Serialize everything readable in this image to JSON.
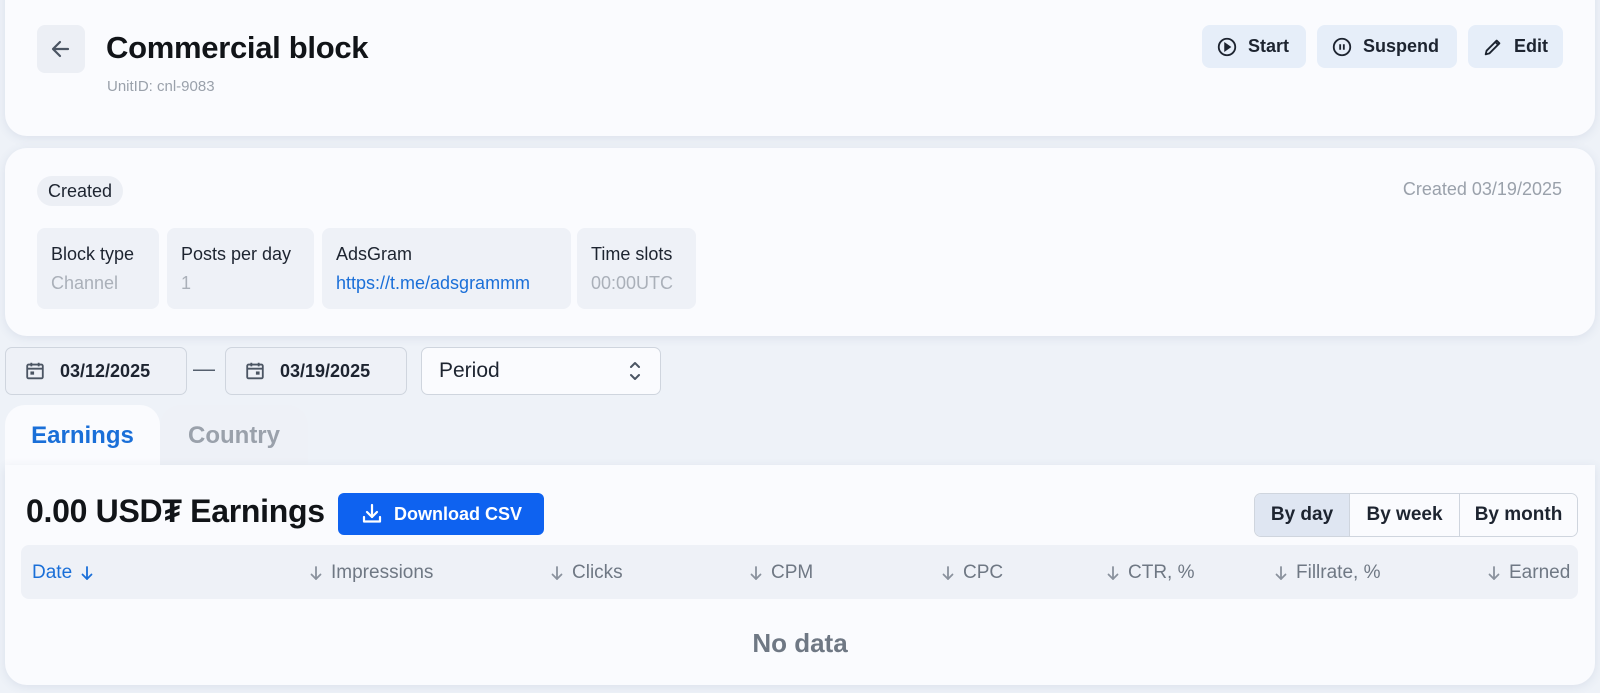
{
  "header": {
    "title": "Commercial block",
    "unit_id": "UnitID: cnl-9083",
    "actions": {
      "start": "Start",
      "suspend": "Suspend",
      "edit": "Edit"
    },
    "icons": [
      "arrow-left-icon",
      "play-circle-icon",
      "pause-circle-icon",
      "pencil-icon"
    ]
  },
  "info": {
    "status": "Created",
    "created": "Created 03/19/2025",
    "properties": [
      {
        "label": "Block type",
        "value": "Channel"
      },
      {
        "label": "Posts per day",
        "value": "1"
      },
      {
        "label": "AdsGram",
        "value": "https://t.me/adsgrammm"
      },
      {
        "label": "Time slots",
        "value": "00:00UTC"
      }
    ]
  },
  "filters": {
    "date_from": "03/12/2025",
    "separator": "—",
    "date_to": "03/19/2025",
    "period": "Period"
  },
  "tabs": [
    {
      "label": "Earnings",
      "active": true
    },
    {
      "label": "Country",
      "active": false
    }
  ],
  "earnings": {
    "title": "0.00 USD₮ Earnings",
    "download_label": "Download CSV",
    "granularity": [
      {
        "label": "By day",
        "active": true
      },
      {
        "label": "By week",
        "active": false
      },
      {
        "label": "By month",
        "active": false
      }
    ],
    "columns": [
      "Date",
      "Impressions",
      "Clicks",
      "CPM",
      "CPC",
      "CTR, %",
      "Fillrate, %",
      "Earned"
    ],
    "empty_text": "No data"
  },
  "colors": {
    "accent": "#1a6fd8",
    "primary_button": "#0e62f0",
    "background": "#eef2f8",
    "card": "#fafbfe"
  }
}
